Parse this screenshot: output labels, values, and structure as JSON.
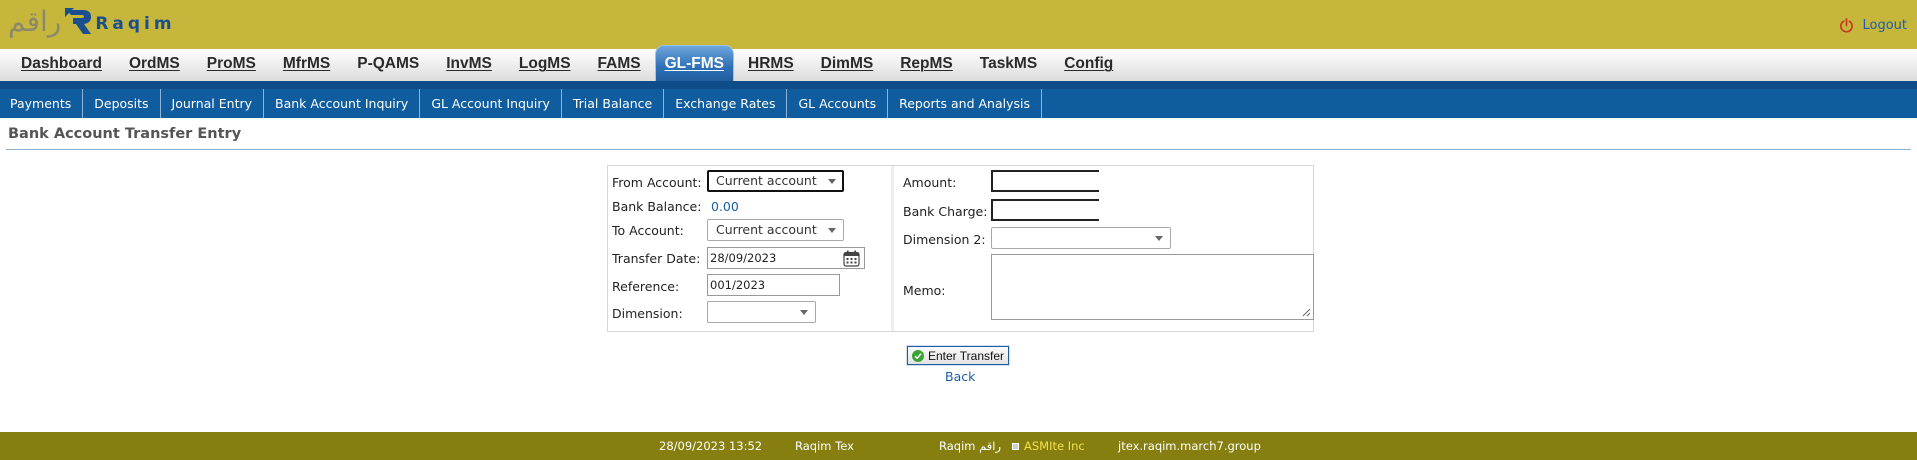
{
  "header": {
    "logo_arabic": "راقم",
    "logo_english": "Raqim",
    "logout_label": "Logout"
  },
  "main_nav": [
    {
      "label": "Dashboard",
      "underline": true
    },
    {
      "label": "OrdMS",
      "underline": true
    },
    {
      "label": "ProMS",
      "underline": true
    },
    {
      "label": "MfrMS",
      "underline": true
    },
    {
      "label": "P-QAMS",
      "underline": false
    },
    {
      "label": "InvMS",
      "underline": true
    },
    {
      "label": "LogMS",
      "underline": true
    },
    {
      "label": "FAMS",
      "underline": true
    },
    {
      "label": "GL-FMS",
      "underline": true,
      "active": true
    },
    {
      "label": "HRMS",
      "underline": true
    },
    {
      "label": "DimMS",
      "underline": true
    },
    {
      "label": "RepMS",
      "underline": true
    },
    {
      "label": "TaskMS",
      "underline": false
    },
    {
      "label": "Config",
      "underline": true
    }
  ],
  "sub_nav": [
    "Payments",
    "Deposits",
    "Journal Entry",
    "Bank Account Inquiry",
    "GL Account Inquiry",
    "Trial Balance",
    "Exchange Rates",
    "GL Accounts",
    "Reports and Analysis"
  ],
  "page": {
    "title": "Bank Account Transfer Entry"
  },
  "form": {
    "from_account_label": "From Account:",
    "from_account_value": "Current account",
    "bank_balance_label": "Bank Balance:",
    "bank_balance_value": "0.00",
    "to_account_label": "To Account:",
    "to_account_value": "Current account",
    "transfer_date_label": "Transfer Date:",
    "transfer_date_value": "28/09/2023",
    "reference_label": "Reference:",
    "reference_value": "001/2023",
    "dimension_label": "Dimension:",
    "dimension_value": "",
    "amount_label": "Amount:",
    "amount_value": "",
    "bank_charge_label": "Bank Charge:",
    "bank_charge_value": "",
    "dimension2_label": "Dimension 2:",
    "dimension2_value": "",
    "memo_label": "Memo:",
    "memo_value": ""
  },
  "actions": {
    "enter_transfer_label": "Enter Transfer",
    "back_label": "Back"
  },
  "footer": {
    "datetime": "28/09/2023 13:52",
    "user": "Raqim Tex",
    "brand": "Raqim راقم",
    "company": "ASMIte Inc",
    "domain": "jtex.raqim.march7.group"
  },
  "colors": {
    "header_bg": "#c6b63c",
    "nav_active": "#2e6fb5",
    "subnav_bg": "#0f5c9e",
    "footer_bg": "#867f10",
    "link": "#1c5fa8",
    "footer_company": "#f1e04a"
  }
}
